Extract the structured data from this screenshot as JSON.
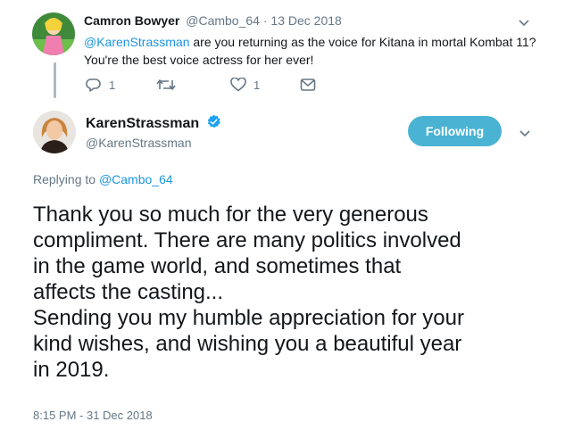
{
  "parent_tweet": {
    "display_name": "Camron Bowyer",
    "handle": "@Cambo_64",
    "date": "13 Dec 2018",
    "mention": "@KarenStrassman",
    "text_line1_rest": " are you returning as the voice for Kitana in mortal Kombat 11?",
    "text_line2": "You're the best voice actress for her ever!",
    "reply_count": "1",
    "like_count": "1"
  },
  "main_tweet": {
    "display_name": "KarenStrassman",
    "handle": "@KarenStrassman",
    "follow_label": "Following",
    "replying_prefix": "Replying to ",
    "replying_to": "@Cambo_64",
    "text": "Thank you so much for the very generous\ncompliment. There are many politics involved\nin the game world, and sometimes that\naffects the casting...\nSending you my humble appreciation for your\nkind wishes, and wishing you a beautiful year\nin 2019.",
    "timestamp": "8:15 PM - 31 Dec 2018"
  },
  "colors": {
    "link": "#1b95e0",
    "follow_button": "#4ab3d4",
    "verified": "#1da1f2",
    "muted": "#657786"
  },
  "icons": [
    "reply-icon",
    "retweet-icon",
    "like-icon",
    "dm-icon",
    "chevron-down-icon",
    "verified-badge-icon"
  ]
}
